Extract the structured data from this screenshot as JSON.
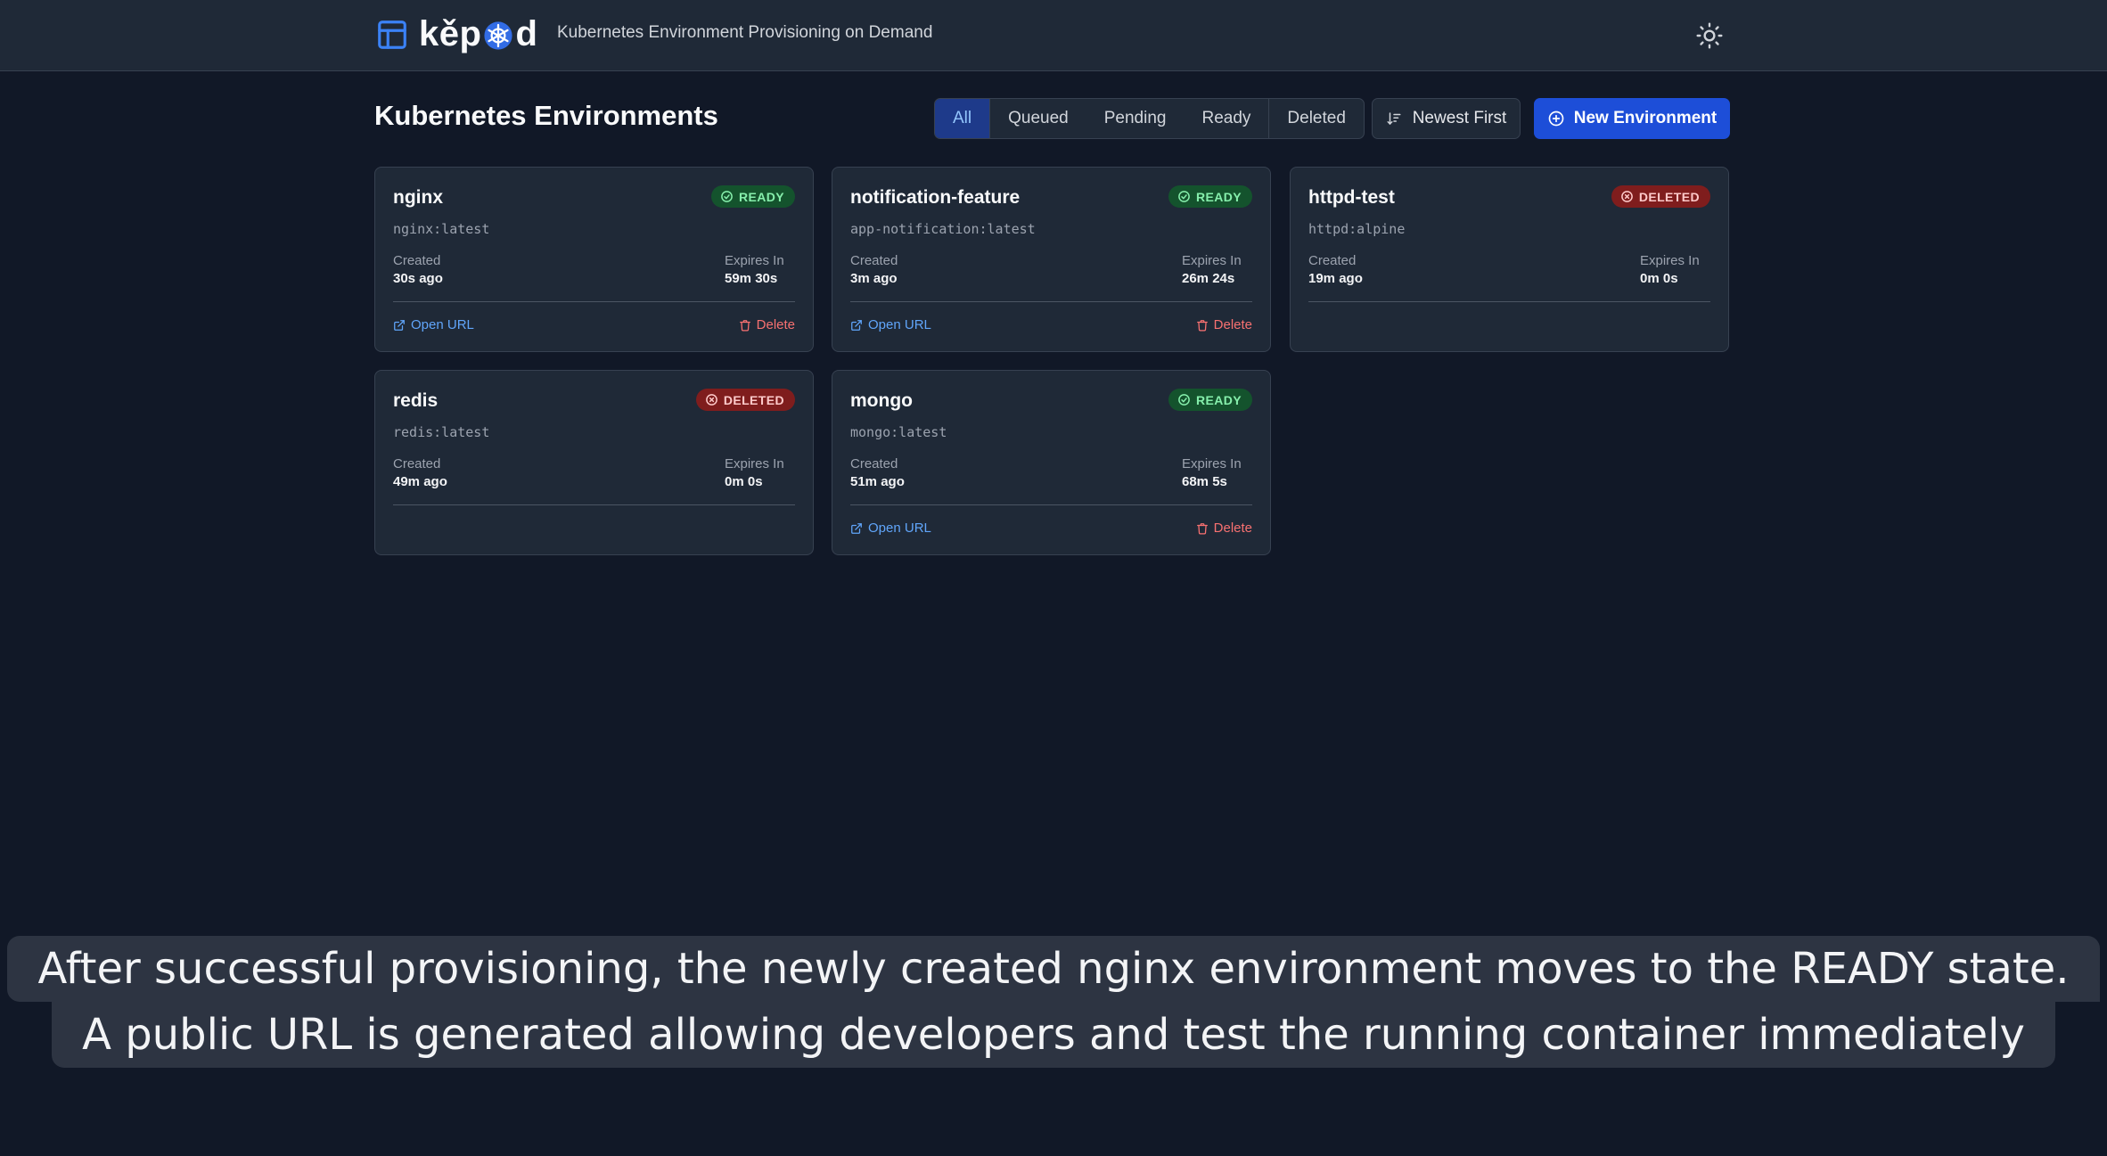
{
  "header": {
    "logo_text_1": "kěp",
    "logo_text_2": "d",
    "tagline": "Kubernetes Environment Provisioning on Demand",
    "icons": {
      "logo": "layout-panel-icon",
      "wheel": "kubernetes-helm-icon",
      "theme": "sun-icon"
    }
  },
  "toolbar": {
    "title": "Kubernetes Environments",
    "filters": [
      "All",
      "Queued",
      "Pending",
      "Ready",
      "Deleted"
    ],
    "active_filter": "All",
    "sort_label": "Newest First",
    "new_label": "New Environment"
  },
  "labels": {
    "created": "Created",
    "expires": "Expires In",
    "open_url": "Open URL",
    "delete": "Delete"
  },
  "environments": [
    {
      "name": "nginx",
      "status": "READY",
      "image": "nginx:latest",
      "created": "30s ago",
      "expires": "59m 30s"
    },
    {
      "name": "notification-feature",
      "status": "READY",
      "image": "app-notification:latest",
      "created": "3m ago",
      "expires": "26m 24s"
    },
    {
      "name": "httpd-test",
      "status": "DELETED",
      "image": "httpd:alpine",
      "created": "19m ago",
      "expires": "0m 0s"
    },
    {
      "name": "redis",
      "status": "DELETED",
      "image": "redis:latest",
      "created": "49m ago",
      "expires": "0m 0s"
    },
    {
      "name": "mongo",
      "status": "READY",
      "image": "mongo:latest",
      "created": "51m ago",
      "expires": "68m 5s"
    }
  ],
  "caption": {
    "line1": "After successful provisioning, the newly created nginx environment moves to the READY state.",
    "line2": "A public URL is generated allowing developers and test the running container immediately"
  },
  "colors": {
    "accent": "#1d4ed8",
    "ready": "#86efac",
    "deleted": "#fecaca",
    "link": "#60a5fa",
    "danger": "#f87171"
  }
}
